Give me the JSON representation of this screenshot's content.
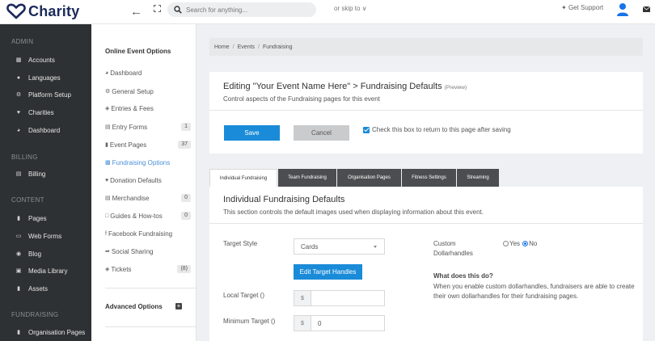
{
  "brand": {
    "name": "Charity",
    "color": "#1a2a5a"
  },
  "topbar": {
    "search_placeholder": "Search for anything...",
    "skip": "or skip to ∨",
    "support": "Get Support"
  },
  "sidebar": {
    "sections": [
      {
        "title": "ADMIN",
        "items": [
          {
            "label": "Accounts",
            "icon": "users-icon"
          },
          {
            "label": "Languages",
            "icon": "globe-icon"
          },
          {
            "label": "Platform Setup",
            "icon": "cogs-icon"
          },
          {
            "label": "Charities",
            "icon": "heart-icon"
          },
          {
            "label": "Dashboard",
            "icon": "dashboard-icon"
          }
        ]
      },
      {
        "title": "BILLING",
        "items": [
          {
            "label": "Billing",
            "icon": "billing-icon"
          }
        ]
      },
      {
        "title": "CONTENT",
        "items": [
          {
            "label": "Pages",
            "icon": "pages-icon"
          },
          {
            "label": "Web Forms",
            "icon": "forms-icon"
          },
          {
            "label": "Blog",
            "icon": "blog-icon"
          },
          {
            "label": "Media Library",
            "icon": "media-icon"
          },
          {
            "label": "Assets",
            "icon": "assets-icon"
          }
        ]
      },
      {
        "title": "FUNDRAISING",
        "items": [
          {
            "label": "Organisation Pages",
            "icon": "org-icon"
          }
        ]
      }
    ]
  },
  "options": {
    "title": "Online Event Options",
    "items": [
      {
        "label": "Dashboard",
        "glyph": "⚙",
        "badge": ""
      },
      {
        "label": "General Setup",
        "glyph": "⚙",
        "badge": ""
      },
      {
        "label": "Entries & Fees",
        "glyph": "◈",
        "badge": ""
      },
      {
        "label": "Entry Forms",
        "glyph": "⌨",
        "badge": "1"
      },
      {
        "label": "Event Pages",
        "glyph": "▤",
        "badge": "37"
      },
      {
        "label": "Fundraising Options",
        "glyph": "⚇",
        "badge": "",
        "active": true
      },
      {
        "label": "Donation Defaults",
        "glyph": "♥",
        "badge": ""
      },
      {
        "label": "Merchandise",
        "glyph": "☶",
        "badge": "0"
      },
      {
        "label": "Guides & How-tos",
        "glyph": "▢",
        "badge": "0"
      },
      {
        "label": "Facebook Fundraising",
        "glyph": "f",
        "badge": ""
      },
      {
        "label": "Social Sharing",
        "glyph": "➦",
        "badge": ""
      },
      {
        "label": "Tickets",
        "glyph": "◈",
        "badge": "(8)"
      }
    ],
    "advanced": "Advanced Options"
  },
  "breadcrumb": [
    "Home",
    "Events",
    "Fundraising"
  ],
  "editor": {
    "title": "Editing \"Your Event Name Here\" > Fundraising Defaults",
    "preview": "(Preview)",
    "subtitle": "Control aspects of the Fundraising pages for this event",
    "save": "Save",
    "cancel": "Cancel",
    "return_check": "Check this box to return to this page after saving"
  },
  "tabs": [
    {
      "label": "Individual Fundraising",
      "active": true
    },
    {
      "label": "Team Fundraising"
    },
    {
      "label": "Organisation Pages"
    },
    {
      "label": "Fitness Settings"
    },
    {
      "label": "Streaming"
    }
  ],
  "individual": {
    "title": "Individual Fundraising Defaults",
    "subtitle": "This section controls the default images used when displaying information about this event.",
    "target_style_label": "Target Style",
    "target_style_value": "Cards",
    "edit_handles": "Edit Target Handles",
    "local_target_label": "Local Target ()",
    "local_prefix": "$",
    "local_value": "",
    "min_target_label": "Minimum Target ()",
    "min_prefix": "$",
    "min_value": "0",
    "custom_label": "Custom Dollarhandles",
    "yes": "Yes",
    "no": "No",
    "what_title": "What does this do?",
    "what_text": "When you enable custom dollarhandles, fundraisers are able to create their own dollarhandles for their fundraising pages."
  },
  "colors": {
    "primary": "#1a8bd8",
    "sidebar": "#2e3133",
    "active_link": "#4a90d9"
  }
}
